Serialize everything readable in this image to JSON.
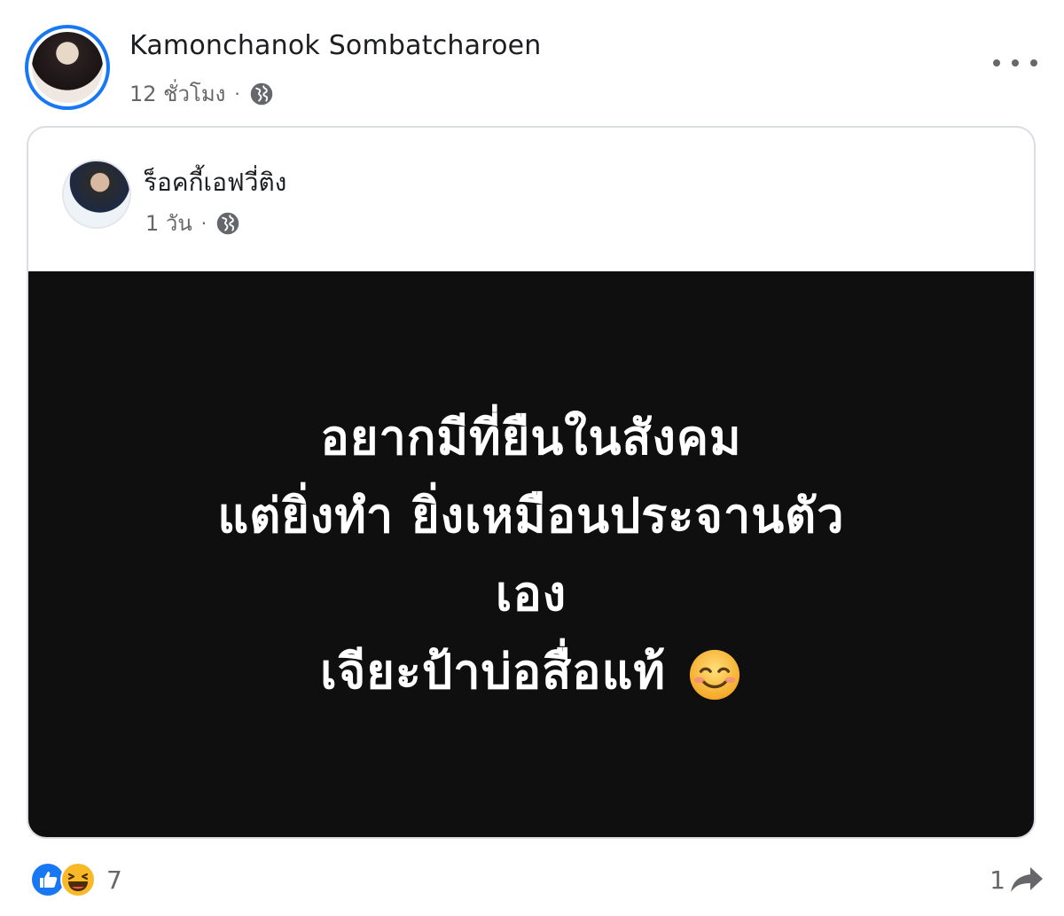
{
  "post": {
    "author": "Kamonchanok Sombatcharoen",
    "time": "12 ชั่วโมง",
    "privacy_icon": "globe-icon",
    "more_icon": "more-horizontal-icon"
  },
  "shared_post": {
    "author": "ร็อคกี้เอฟวี่ติง",
    "time": "1 วัน",
    "privacy_icon": "globe-icon",
    "background_color": "#0f0f0f",
    "text_lines": [
      "อยากมีที่ยืนในสังคม",
      "แต่ยิ่งทำ ยิ่งเหมือนประจานตัว",
      "เอง",
      "เจียะป้าบ่อสื่อแท้"
    ],
    "trailing_emoji": "smiling-face-icon"
  },
  "footer": {
    "reaction_icons": [
      "like-icon",
      "haha-icon"
    ],
    "reaction_count": "7",
    "share_count": "1",
    "share_icon": "share-arrow-icon"
  },
  "colors": {
    "accent": "#1877f2",
    "secondary_text": "#65676b"
  }
}
